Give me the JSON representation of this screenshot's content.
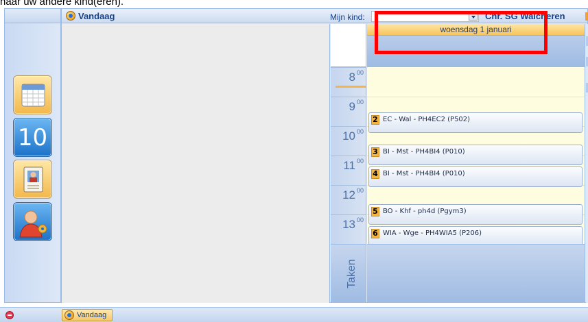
{
  "caption": "naar uw andere kind(eren).",
  "panel": {
    "title": "Vandaag",
    "child_label": "Mijn kind:",
    "child_value": "",
    "school": "Chr. SG Walcheren"
  },
  "sidebar": {
    "tiles": [
      {
        "name": "calendar",
        "label": ""
      },
      {
        "name": "grades",
        "label": "10"
      },
      {
        "name": "student-card",
        "label": ""
      },
      {
        "name": "user-settings",
        "label": ""
      }
    ]
  },
  "calendar": {
    "day_header": "woensdag 1 januari",
    "hours": [
      {
        "h": "8",
        "m": "00"
      },
      {
        "h": "9",
        "m": "00"
      },
      {
        "h": "10",
        "m": "00"
      },
      {
        "h": "11",
        "m": "00"
      },
      {
        "h": "12",
        "m": "00"
      },
      {
        "h": "13",
        "m": "00"
      }
    ],
    "appointments": [
      {
        "num": "2",
        "text": "EC - Wal - PH4EC2  (P502)"
      },
      {
        "num": "3",
        "text": "BI - Mst - PH4BI4  (P010)"
      },
      {
        "num": "4",
        "text": "BI - Mst - PH4BI4  (P010)"
      },
      {
        "num": "5",
        "text": "BO - Khf - ph4d  (Pgym3)"
      },
      {
        "num": "6",
        "text": "WIA - Wge - PH4WIA5  (P206)"
      }
    ],
    "taken_label": "Taken"
  },
  "taskbar": {
    "button_label": "Vandaag"
  },
  "colors": {
    "accent_red": "#ff0000",
    "header_blue": "#15428b",
    "day_header_gold": "#f7c55d"
  }
}
